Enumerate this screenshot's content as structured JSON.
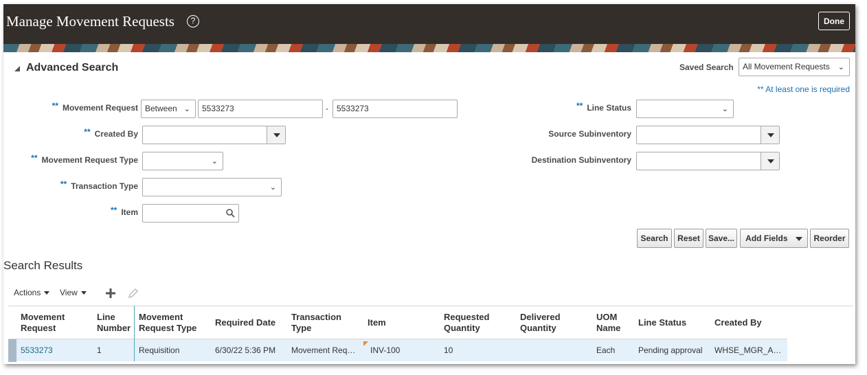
{
  "header": {
    "title": "Manage Movement Requests",
    "help_icon": "?",
    "done_label": "Done"
  },
  "advanced_search": {
    "title": "Advanced Search",
    "saved_search_label": "Saved Search",
    "saved_search_value": "All Movement Requests",
    "required_note": "** At least one is required",
    "required_marker": "**",
    "fields": {
      "movement_request": {
        "label": "Movement Request",
        "operator": "Between",
        "from": "5533273",
        "to": "5533273",
        "separator": "-"
      },
      "created_by": {
        "label": "Created By",
        "value": ""
      },
      "movement_request_type": {
        "label": "Movement Request Type",
        "value": ""
      },
      "transaction_type": {
        "label": "Transaction Type",
        "value": ""
      },
      "item": {
        "label": "Item",
        "value": ""
      },
      "line_status": {
        "label": "Line Status",
        "value": ""
      },
      "source_subinventory": {
        "label": "Source Subinventory",
        "value": ""
      },
      "destination_subinventory": {
        "label": "Destination Subinventory",
        "value": ""
      }
    },
    "buttons": {
      "search": "Search",
      "reset": "Reset",
      "save": "Save...",
      "add_fields": "Add Fields",
      "reorder": "Reorder"
    }
  },
  "results": {
    "title": "Search Results",
    "toolbar": {
      "actions": "Actions",
      "view": "View"
    },
    "columns": [
      {
        "line1": "Movement",
        "line2": "Request"
      },
      {
        "line1": "Line",
        "line2": "Number"
      },
      {
        "line1": "Movement",
        "line2": "Request Type"
      },
      {
        "line1": "Required Date",
        "line2": ""
      },
      {
        "line1": "Transaction",
        "line2": "Type"
      },
      {
        "line1": "Item",
        "line2": ""
      },
      {
        "line1": "Requested",
        "line2": "Quantity"
      },
      {
        "line1": "Delivered",
        "line2": "Quantity"
      },
      {
        "line1": "UOM",
        "line2": "Name"
      },
      {
        "line1": "Line Status",
        "line2": ""
      },
      {
        "line1": "Created By",
        "line2": ""
      }
    ],
    "rows": [
      {
        "movement_request": "5533273",
        "line_number": "1",
        "movement_request_type": "Requisition",
        "required_date": "6/30/22 5:36 PM",
        "transaction_type": "Movement Req…",
        "item": "INV-100",
        "requested_quantity": "10",
        "delivered_quantity": "",
        "uom_name": "Each",
        "line_status": "Pending approval",
        "created_by": "WHSE_MGR_A…"
      }
    ]
  },
  "colors": {
    "header_bg": "#332e2a",
    "link": "#1c6b8a",
    "required_marker": "#1a6fb0",
    "selected_row": "#e4f0fa"
  }
}
